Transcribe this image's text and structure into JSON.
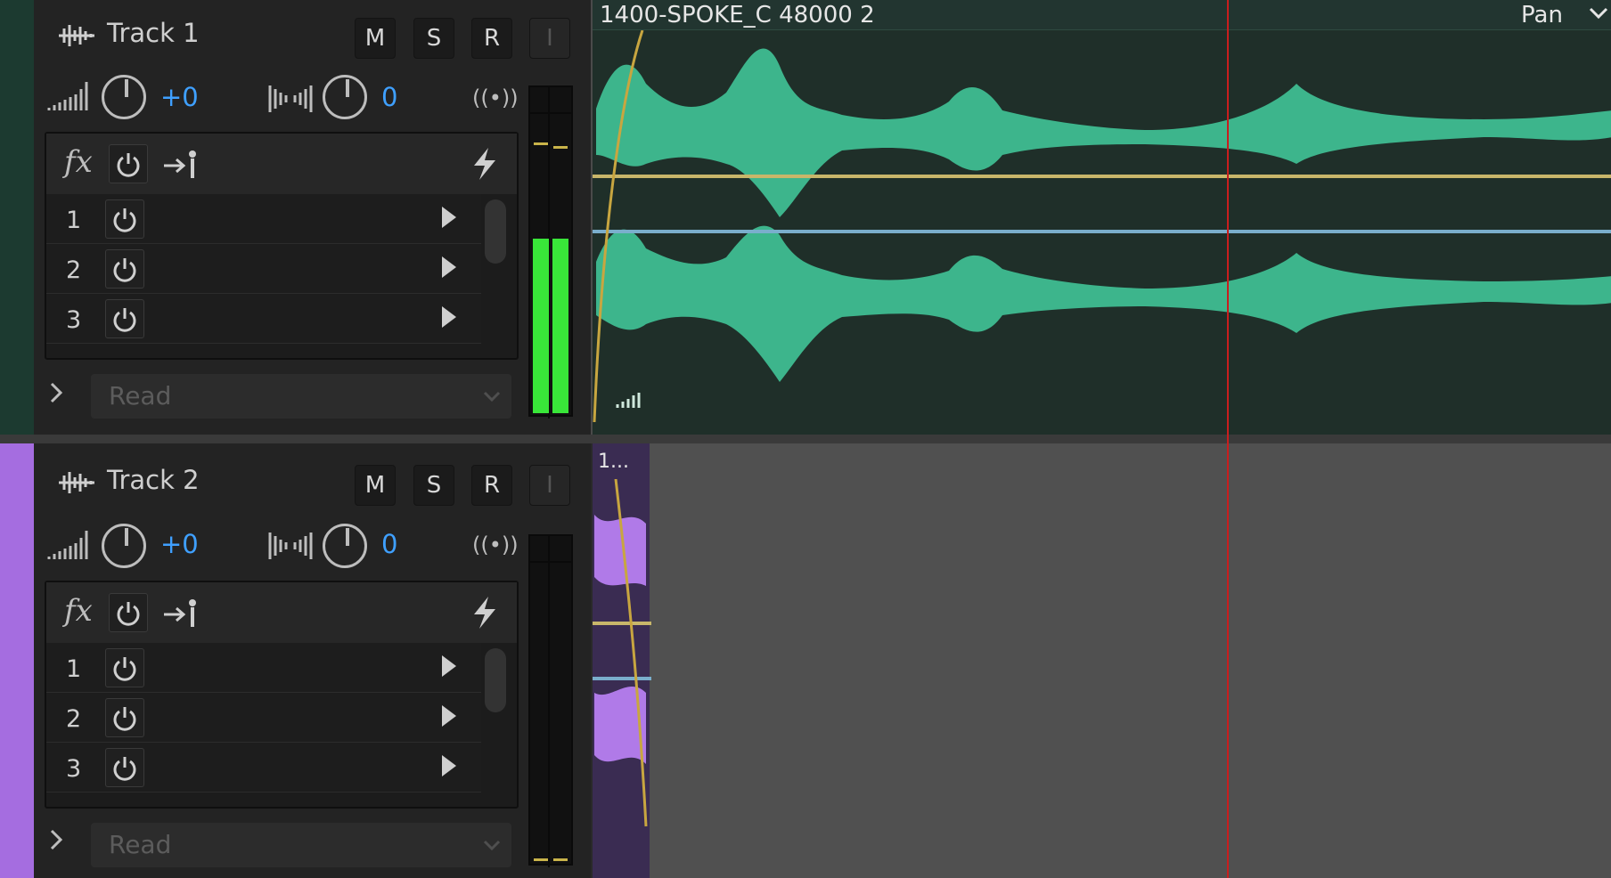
{
  "tracks": [
    {
      "name": "Track 1",
      "volume": "+0",
      "pan": "0",
      "buttons": {
        "mute": "M",
        "solo": "S",
        "record": "R",
        "input": "I"
      },
      "fx_label": "fx",
      "slots": [
        "1",
        "2",
        "3"
      ],
      "automation_mode": "Read",
      "color": "#1f4a3a"
    },
    {
      "name": "Track 2",
      "volume": "+0",
      "pan": "0",
      "buttons": {
        "mute": "M",
        "solo": "S",
        "record": "R",
        "input": "I"
      },
      "fx_label": "fx",
      "slots": [
        "1",
        "2",
        "3"
      ],
      "automation_mode": "Read",
      "color": "#a56de0"
    }
  ],
  "clips": {
    "track1": {
      "name": "1400-SPOKE_C 48000 2",
      "lane_param": "Pan",
      "color": "#3db58c"
    },
    "track2": {
      "name": "1...",
      "color": "#b07ae8"
    }
  },
  "colors": {
    "playhead": "#c81e1e",
    "volume_env": "#c8b66a",
    "pan_env": "#7aaecc",
    "meter_green": "#39e639"
  }
}
